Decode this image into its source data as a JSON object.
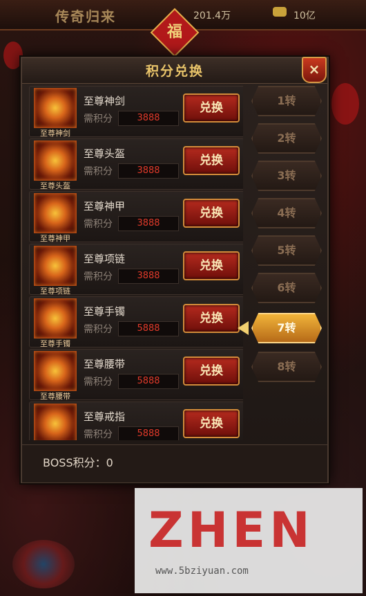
{
  "topbar": {
    "game_title": "传奇归来",
    "currency_value": "201.4万",
    "secondary_value": "10亿",
    "fu_char": "福"
  },
  "panel": {
    "title": "积分兑换",
    "close_label": "×",
    "boss_points_label": "BOSS积分：0"
  },
  "items": [
    {
      "name": "至尊神剑",
      "icon_label": "至尊神剑",
      "cost_label": "需积分",
      "cost": "3888",
      "button": "兑换"
    },
    {
      "name": "至尊头盔",
      "icon_label": "至尊头盔",
      "cost_label": "需积分",
      "cost": "3888",
      "button": "兑换"
    },
    {
      "name": "至尊神甲",
      "icon_label": "至尊神甲",
      "cost_label": "需积分",
      "cost": "3888",
      "button": "兑换"
    },
    {
      "name": "至尊项链",
      "icon_label": "至尊项链",
      "cost_label": "需积分",
      "cost": "3888",
      "button": "兑换"
    },
    {
      "name": "至尊手镯",
      "icon_label": "至尊手镯",
      "cost_label": "需积分",
      "cost": "5888",
      "button": "兑换"
    },
    {
      "name": "至尊腰带",
      "icon_label": "至尊腰带",
      "cost_label": "需积分",
      "cost": "5888",
      "button": "兑换"
    },
    {
      "name": "至尊戒指",
      "icon_label": "",
      "cost_label": "需积分",
      "cost": "5888",
      "button": "兑换"
    }
  ],
  "tabs": [
    {
      "label": "1转",
      "active": false
    },
    {
      "label": "2转",
      "active": false
    },
    {
      "label": "3转",
      "active": false
    },
    {
      "label": "4转",
      "active": false
    },
    {
      "label": "5转",
      "active": false
    },
    {
      "label": "6转",
      "active": false
    },
    {
      "label": "7转",
      "active": true
    },
    {
      "label": "8转",
      "active": false
    }
  ],
  "watermark": {
    "main": "ZHEN",
    "sub": "www.5bziyuan.com"
  },
  "colors": {
    "accent_gold": "#e9c46a",
    "button_red": "#b52a1e",
    "cost_red": "#e13a2a",
    "active_tab": "#f1b43a"
  }
}
